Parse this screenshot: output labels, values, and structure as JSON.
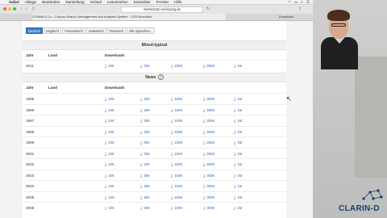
{
  "menubar": {
    "items": [
      "Safari",
      "Ablage",
      "Bearbeiten",
      "Darstellung",
      "Verlauf",
      "Lesezeichen",
      "Entwickler",
      "Fenster",
      "Hilfe"
    ]
  },
  "browser": {
    "address": "wortschatz.uni-leipzig.de",
    "tab_label": "CONAN & Co - Corpus Search, Management and Analysis System - CSS Munchkin",
    "download_label": "Download"
  },
  "languages": [
    "Deutsch",
    "Englisch",
    "Französisch",
    "Italienisch",
    "Russisch",
    "Alle Sprachen..."
  ],
  "sections": {
    "mixed": {
      "title": "Mixed-typical",
      "col_year": "Jahr",
      "col_land": "Land",
      "col_downloads": "Downloads",
      "rows": [
        {
          "year": "2011",
          "downloads": [
            "10K",
            "30K",
            "100K",
            "300K",
            "1M"
          ]
        }
      ]
    },
    "news": {
      "title": "News",
      "info_icon": "info-icon",
      "col_year": "Jahr",
      "col_land": "Land",
      "col_downloads": "Downloads",
      "rows": [
        {
          "year": "1995",
          "downloads": [
            "10K",
            "30K",
            "100K",
            "300K",
            "1M"
          ]
        },
        {
          "year": "1996",
          "downloads": [
            "10K",
            "30K",
            "100K",
            "300K",
            "1M"
          ]
        },
        {
          "year": "1997",
          "downloads": [
            "10K",
            "30K",
            "100K",
            "300K",
            "1M"
          ]
        },
        {
          "year": "1998",
          "downloads": [
            "10K",
            "30K",
            "100K",
            "300K",
            "1M"
          ]
        },
        {
          "year": "1999",
          "downloads": [
            "10K",
            "30K",
            "100K",
            "300K",
            "1M"
          ]
        },
        {
          "year": "2001",
          "downloads": [
            "10K",
            "30K",
            "100K",
            "300K",
            "1M"
          ]
        },
        {
          "year": "2002",
          "downloads": [
            "10K",
            "30K",
            "100K",
            "300K",
            "1M"
          ]
        },
        {
          "year": "2003",
          "downloads": [
            "10K",
            "30K",
            "100K",
            "300K",
            "1M"
          ]
        },
        {
          "year": "2004",
          "downloads": [
            "10K",
            "30K",
            "100K",
            "300K",
            "1M"
          ]
        },
        {
          "year": "2005",
          "downloads": [
            "10K",
            "30K",
            "100K",
            "300K",
            "1M"
          ]
        },
        {
          "year": "2006",
          "downloads": [
            "10K",
            "30K",
            "100K",
            "300K",
            "1M"
          ]
        }
      ]
    }
  },
  "logo": "CLARIN-D",
  "colors": {
    "accent": "#3a7bc8",
    "link": "#2a6cb8",
    "logo": "#123f73"
  }
}
